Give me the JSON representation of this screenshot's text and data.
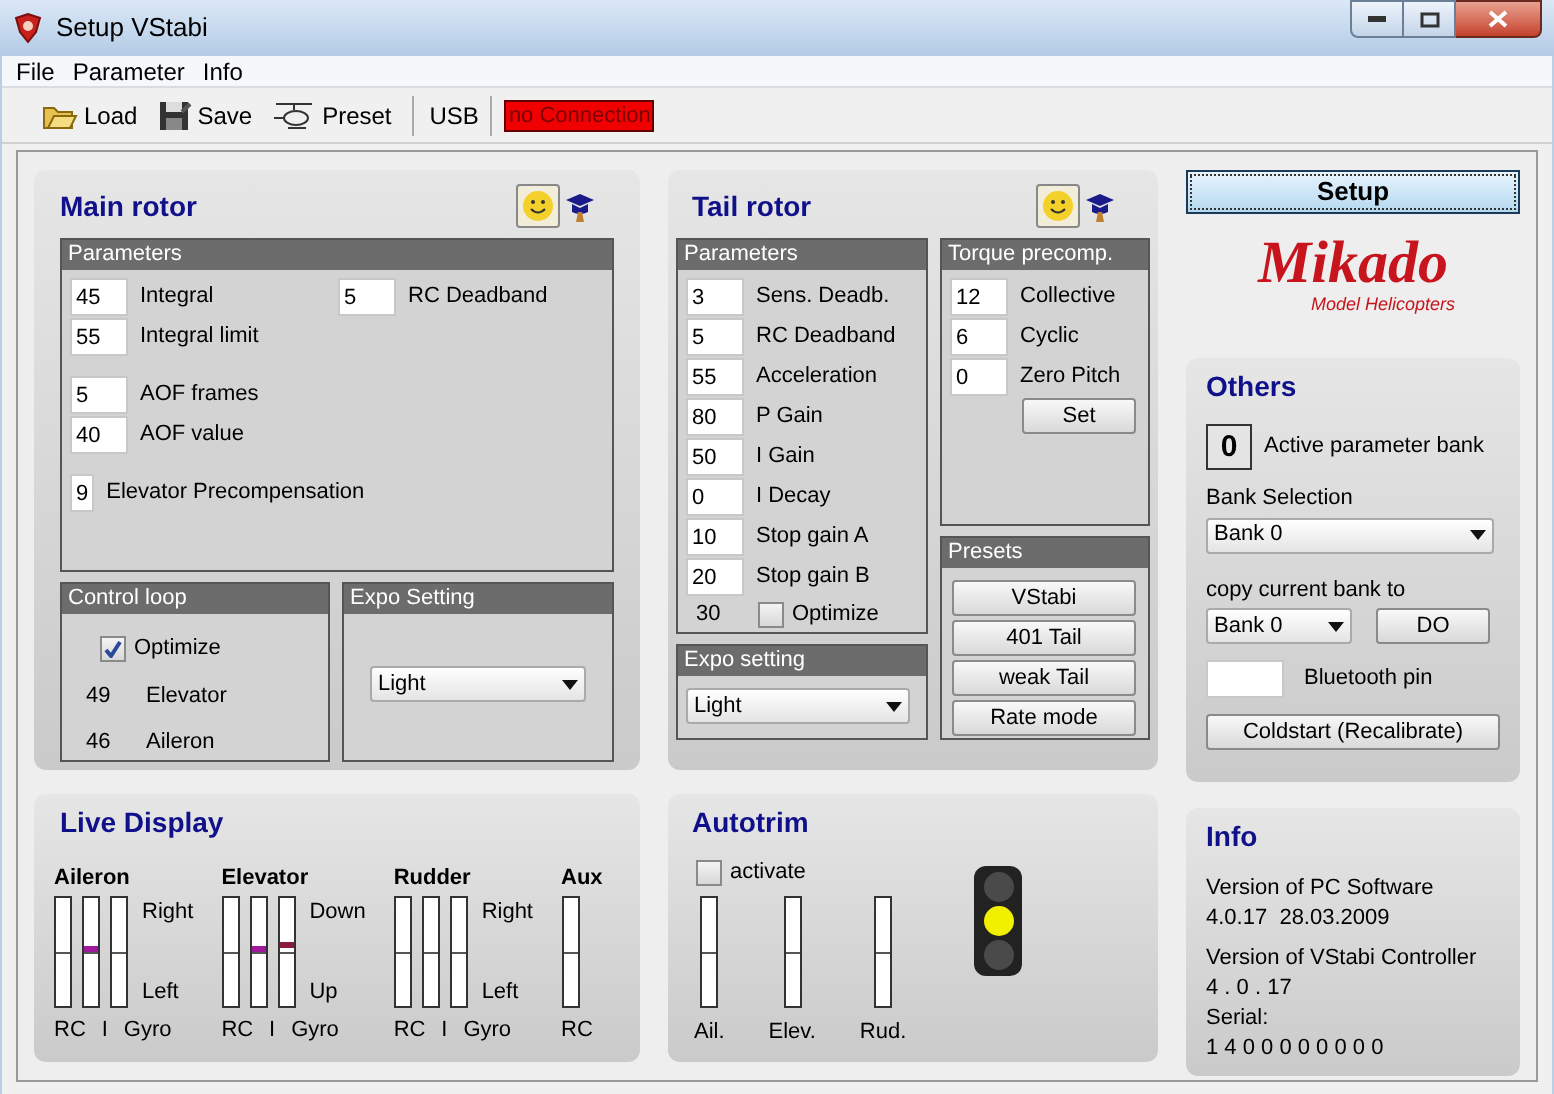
{
  "window": {
    "title": "Setup VStabi"
  },
  "menu": [
    "File",
    "Parameter",
    "Info"
  ],
  "toolbar": {
    "buttons": [
      {
        "label": "Load",
        "kind": "load"
      },
      {
        "label": "Save",
        "kind": "save"
      },
      {
        "label": "Preset",
        "kind": "preset"
      }
    ],
    "port": "USB",
    "connection": "no Connection"
  },
  "main_rotor": {
    "title": "Main rotor",
    "parameters": {
      "title": "Parameters",
      "groups": [
        [
          {
            "value": "45",
            "label": "Integral"
          },
          {
            "value": "55",
            "label": "Integral limit"
          }
        ],
        [
          {
            "value": "5",
            "label": "AOF frames"
          },
          {
            "value": "40",
            "label": "AOF value"
          }
        ],
        [
          {
            "value": "9",
            "label": "Elevator Precompensation"
          }
        ]
      ],
      "side_field": {
        "value": "5",
        "label": "RC Deadband"
      }
    },
    "control_loop": {
      "title": "Control loop",
      "optimize": {
        "label": "Optimize",
        "checked": true
      },
      "rows": [
        {
          "value": "49",
          "label": "Elevator"
        },
        {
          "value": "46",
          "label": "Aileron"
        }
      ]
    },
    "expo": {
      "title": "Expo Setting",
      "value": "Light"
    }
  },
  "tail_rotor": {
    "title": "Tail rotor",
    "parameters": {
      "title": "Parameters",
      "fields": [
        {
          "value": "3",
          "label": "Sens. Deadb."
        },
        {
          "value": "5",
          "label": "RC Deadband"
        },
        {
          "value": "55",
          "label": "Acceleration"
        },
        {
          "value": "80",
          "label": "P Gain"
        },
        {
          "value": "50",
          "label": "I Gain"
        },
        {
          "value": "0",
          "label": "I Decay"
        },
        {
          "value": "10",
          "label": "Stop gain A"
        },
        {
          "value": "20",
          "label": "Stop gain B"
        }
      ],
      "reading": "30",
      "optimize": {
        "label": "Optimize",
        "checked": false
      }
    },
    "torque": {
      "title": "Torque precomp.",
      "fields": [
        {
          "value": "12",
          "label": "Collective"
        },
        {
          "value": "6",
          "label": "Cyclic"
        },
        {
          "value": "0",
          "label": "Zero Pitch"
        }
      ],
      "button": "Set"
    },
    "presets": {
      "title": "Presets",
      "buttons": [
        "VStabi",
        "401 Tail",
        "weak Tail",
        "Rate mode"
      ]
    },
    "expo": {
      "title": "Expo setting",
      "value": "Light"
    }
  },
  "setup_button": "Setup",
  "logo": {
    "name": "Mikado",
    "tagline": "Model Helicopters"
  },
  "others": {
    "title": "Others",
    "active_bank": "0",
    "active_bank_label": "Active parameter bank",
    "bank_selection_label": "Bank Selection",
    "bank_selection": "Bank 0",
    "copy_label": "copy current bank to",
    "copy_target": "Bank 0",
    "do_button": "DO",
    "bluetooth_label": "Bluetooth pin",
    "coldstart_button": "Coldstart (Recalibrate)"
  },
  "live_display": {
    "title": "Live Display",
    "groups": [
      {
        "name": "Aileron",
        "top": "Right",
        "bottom": "Left",
        "bars": [
          {
            "label": "RC"
          },
          {
            "label": "I",
            "level": 0.53,
            "color": "#a0189c"
          },
          {
            "label": "Gyro"
          }
        ]
      },
      {
        "name": "Elevator",
        "top": "Down",
        "bottom": "Up",
        "bars": [
          {
            "label": "RC"
          },
          {
            "label": "I",
            "level": 0.53,
            "color": "#a0189c"
          },
          {
            "label": "Gyro",
            "level": 0.56,
            "color": "#8c1c3c"
          }
        ]
      },
      {
        "name": "Rudder",
        "top": "Right",
        "bottom": "Left",
        "bars": [
          {
            "label": "RC"
          },
          {
            "label": "I"
          },
          {
            "label": "Gyro"
          }
        ]
      },
      {
        "name": "Aux",
        "bars": [
          {
            "label": "RC"
          }
        ]
      }
    ]
  },
  "autotrim": {
    "title": "Autotrim",
    "activate": {
      "label": "activate",
      "checked": false
    },
    "bars": [
      "Ail.",
      "Elev.",
      "Rud."
    ],
    "lights": [
      {
        "on": false
      },
      {
        "on": true,
        "color": "#f0f000"
      },
      {
        "on": false
      }
    ]
  },
  "info": {
    "title": "Info",
    "lines": [
      "Version of PC Software",
      "4.0.17  28.03.2009",
      "Version of VStabi Controller",
      "4 . 0 . 17",
      "Serial:",
      "1 4 0 0 0 0 0 0 0 0"
    ]
  }
}
